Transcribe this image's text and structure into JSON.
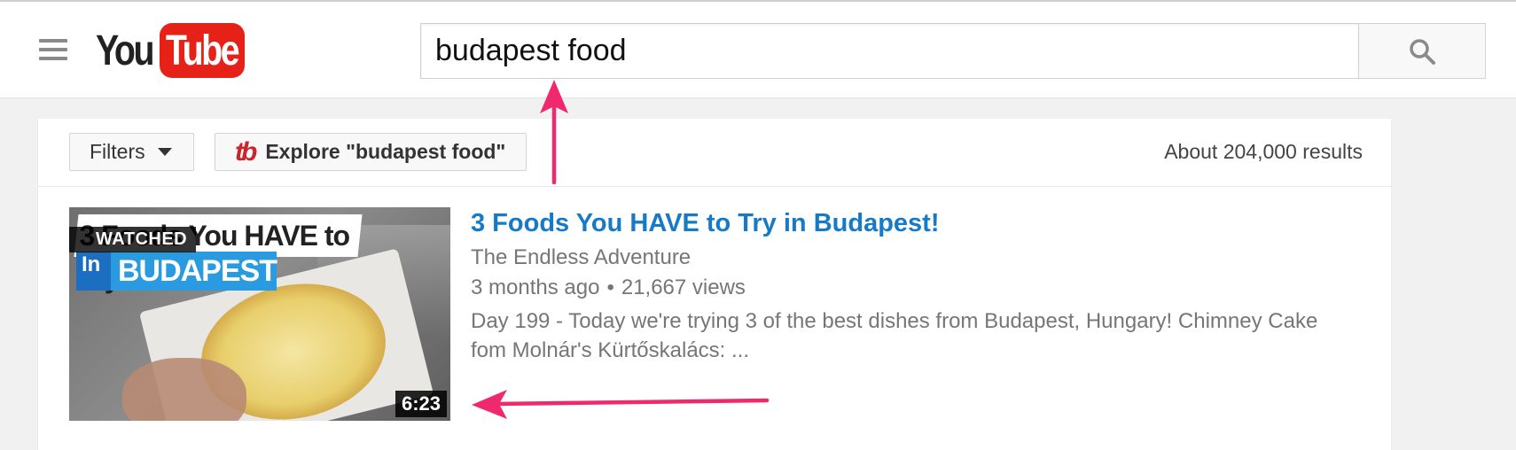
{
  "header": {
    "logo": {
      "you": "You",
      "tube": "Tube"
    },
    "search": {
      "value": "budapest food"
    }
  },
  "filter_bar": {
    "filters_label": "Filters",
    "explore_icon": "tb",
    "explore_label": "Explore \"budapest food\"",
    "results_count": "About 204,000 results"
  },
  "result": {
    "thumbnail": {
      "overlay_title": "3 Foods You HAVE to Try",
      "overlay_in": "In",
      "overlay_city": "BUDAPEST",
      "watched_badge": "WATCHED",
      "duration": "6:23"
    },
    "title": "3 Foods You HAVE to Try in Budapest!",
    "channel": "The Endless Adventure",
    "age": "3 months ago",
    "separator": "•",
    "views": "21,667 views",
    "description": "Day 199 - Today we're trying 3 of the best dishes from Budapest, Hungary! Chimney Cake fom Molnár's Kürtőskalács: ..."
  },
  "colors": {
    "brand_red": "#e62117",
    "link_blue": "#167ac6",
    "annotation_pink": "#f0286e"
  },
  "icons": [
    "hamburger-menu-icon",
    "search-icon",
    "caret-down-icon",
    "tubebuddy-icon"
  ]
}
